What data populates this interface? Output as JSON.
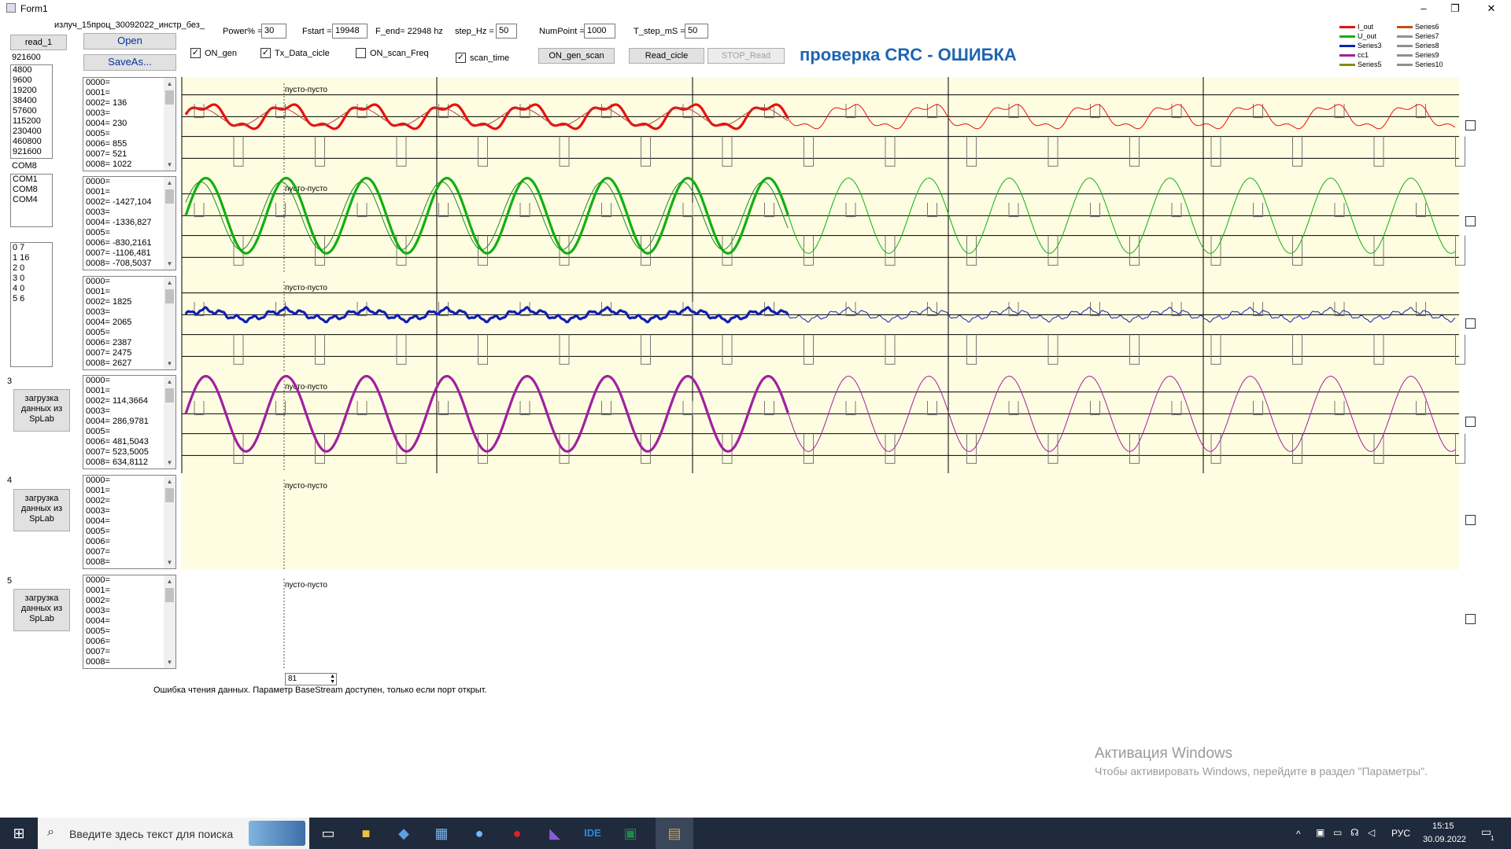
{
  "window": {
    "title": "Form1"
  },
  "header": {
    "filename": "излуч_15проц_30092022_инстр_без_"
  },
  "toolbar": {
    "read_label": "read_1",
    "open_label": "Open",
    "saveas_label": "SaveAs...",
    "power_label": "Power% =",
    "power_value": "30",
    "fstart_label": "Fstart =",
    "fstart_value": "19948",
    "fend_label": "F_end= 22948 hz",
    "step_label": "step_Hz =",
    "step_value": "50",
    "numpoint_label": "NumPoint =",
    "numpoint_value": "1000",
    "tstep_label": "T_step_mS =",
    "tstep_value": "50",
    "on_gen": "ON_gen",
    "tx_data": "Tx_Data_cicle",
    "on_scan": "ON_scan_Freq",
    "scan_time": "scan_time",
    "on_gen_scan": "ON_gen_scan",
    "read_cicle": "Read_cicle",
    "stop_read": "STOP_Read",
    "crc_status": "проверка CRC - ОШИБКА"
  },
  "left": {
    "baud_selected": "921600",
    "bauds": [
      "4800",
      "9600",
      "19200",
      "38400",
      "57600",
      "115200",
      "230400",
      "460800",
      "921600"
    ],
    "port_selected": "COM8",
    "ports": [
      "COM1",
      "COM8",
      "COM4"
    ],
    "pairs": [
      "0 7",
      "1 16",
      "2 0",
      "3 0",
      "4 0",
      "5 6"
    ],
    "row3": "3",
    "row4": "4",
    "row5": "5",
    "splab": "загрузка данных из SpLab"
  },
  "registers": [
    [
      "0000=",
      "0001=",
      "0002= 136",
      "0003=",
      "0004= 230",
      "0005=",
      "0006= 855",
      "0007= 521",
      "0008= 1022"
    ],
    [
      "0000=",
      "0001=",
      "0002= -1427,104",
      "0003=",
      "0004= -1336,827",
      "0005=",
      "0006= -830,2161",
      "0007= -1106,481",
      "0008= -708,5037"
    ],
    [
      "0000=",
      "0001=",
      "0002= 1825",
      "0003=",
      "0004= 2065",
      "0005=",
      "0006= 2387",
      "0007= 2475",
      "0008= 2627"
    ],
    [
      "0000=",
      "0001=",
      "0002= 114,3664",
      "0003=",
      "0004= 286,9781",
      "0005=",
      "0006= 481,5043",
      "0007= 523,5005",
      "0008= 634,8112"
    ],
    [
      "0000=",
      "0001=",
      "0002=",
      "0003=",
      "0004=",
      "0005=",
      "0006=",
      "0007=",
      "0008="
    ],
    [
      "0000=",
      "0001=",
      "0002=",
      "0003=",
      "0004=",
      "0005=",
      "0006=",
      "0007=",
      "0008="
    ]
  ],
  "chart_data": {
    "type": "line",
    "cursor_label": "пусто-пусто",
    "legend": [
      {
        "name": "I_out",
        "color": "#e81010"
      },
      {
        "name": "U_out",
        "color": "#10b010"
      },
      {
        "name": "Series3",
        "color": "#1020b0"
      },
      {
        "name": "cc1",
        "color": "#a020a0"
      },
      {
        "name": "Series5",
        "color": "#8a8a10"
      },
      {
        "name": "Series6",
        "color": "#c05010"
      },
      {
        "name": "Series7",
        "color": "#909090"
      },
      {
        "name": "Series8",
        "color": "#909090"
      },
      {
        "name": "Series9",
        "color": "#909090"
      },
      {
        "name": "Series10",
        "color": "#909090"
      }
    ],
    "panels": [
      {
        "name": "I_out",
        "color": "#e81010",
        "periods": 15.8,
        "amp": 0.4,
        "shape": "distorted"
      },
      {
        "name": "U_out",
        "color": "#10b010",
        "periods": 15.8,
        "amp": 1.0,
        "shape": "sine"
      },
      {
        "name": "Series3",
        "color": "#1020b0",
        "periods": 15.8,
        "amp": 0.2,
        "shape": "noisy"
      },
      {
        "name": "cc1",
        "color": "#a020a0",
        "periods": 15.8,
        "amp": 1.0,
        "shape": "sine"
      }
    ]
  },
  "status": {
    "spin_value": "81",
    "error": "Ошибка чтения данных. Параметр BaseStream доступен, только если порт открыт."
  },
  "watermark": {
    "title": "Активация Windows",
    "sub": "Чтобы активировать Windows, перейдите в раздел \"Параметры\"."
  },
  "taskbar": {
    "search_placeholder": "Введите здесь текст для поиска",
    "lang": "РУС",
    "time": "15:15",
    "date": "30.09.2022",
    "notif_count": "1"
  }
}
